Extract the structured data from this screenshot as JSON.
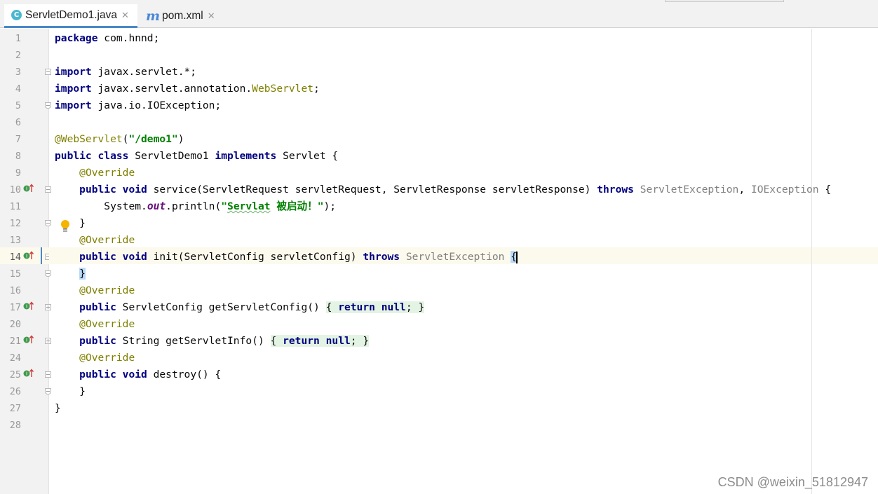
{
  "tabs": [
    {
      "label": "ServletDemo1.java",
      "icon": "class-c-icon",
      "active": true
    },
    {
      "label": "pom.xml",
      "icon": "maven-icon",
      "active": false
    }
  ],
  "editor": {
    "current_line": "14",
    "line_numbers": [
      "1",
      "2",
      "3",
      "4",
      "5",
      "6",
      "7",
      "8",
      "9",
      "10",
      "11",
      "12",
      "13",
      "14",
      "15",
      "16",
      "17",
      "20",
      "21",
      "24",
      "25",
      "26",
      "27",
      "28"
    ],
    "code": {
      "l1_kw": "package",
      "l1_rest": " com.hnnd;",
      "l3_kw": "import",
      "l3_rest": " javax.servlet.*;",
      "l4_kw": "import",
      "l4_rest": " javax.servlet.annotation.",
      "l4_ann": "WebServlet",
      "l4_end": ";",
      "l5_kw": "import",
      "l5_rest": " java.io.IOException;",
      "l7_ann": "@WebServlet",
      "l7_p1": "(",
      "l7_str": "\"/demo1\"",
      "l7_p2": ")",
      "l8_kw1": "public",
      "l8_kw2": "class",
      "l8_name": " ServletDemo1 ",
      "l8_kw3": "implements",
      "l8_rest": " Servlet {",
      "l9_ann": "@Override",
      "l10_kw1": "public",
      "l10_kw2": "void",
      "l10_sig": " service(ServletRequest servletRequest, ServletResponse servletResponse) ",
      "l10_throws": "throws",
      "l10_ex1": "ServletException",
      "l10_comma": ", ",
      "l10_ex2": "IOException",
      "l10_end": " {",
      "l11_a": "System.",
      "l11_fld": "out",
      "l11_b": ".println(",
      "l11_q": "\"",
      "l11_word": "Servlat",
      "l11_str": " 被启动！\"",
      "l11_end": ");",
      "l12": "}",
      "l13_ann": "@Override",
      "l14_kw1": "public",
      "l14_kw2": "void",
      "l14_sig": " init(ServletConfig servletConfig) ",
      "l14_throws": "throws",
      "l14_ex": "ServletException",
      "l14_brace": "{",
      "l15": "}",
      "l16_ann": "@Override",
      "l17_kw1": "public",
      "l17_sig": " ServletConfig getServletConfig() ",
      "l17_b1": "{ ",
      "l17_kw2": "return",
      "l17_kw3": "null",
      "l17_b2": "; }",
      "l20_ann": "@Override",
      "l21_kw1": "public",
      "l21_sig": " String getServletInfo() ",
      "l21_b1": "{ ",
      "l21_kw2": "return",
      "l21_kw3": "null",
      "l21_b2": "; }",
      "l24_ann": "@Override",
      "l25_kw1": "public",
      "l25_kw2": "void",
      "l25_sig": " destroy() {",
      "l26": "}",
      "l27": "}"
    }
  },
  "watermark": "CSDN @weixin_51812947",
  "colors": {
    "keyword": "#000080",
    "annotation": "#808000",
    "string": "#008000",
    "highlight_line": "#fcfaed",
    "tab_accent": "#4a88c7"
  }
}
